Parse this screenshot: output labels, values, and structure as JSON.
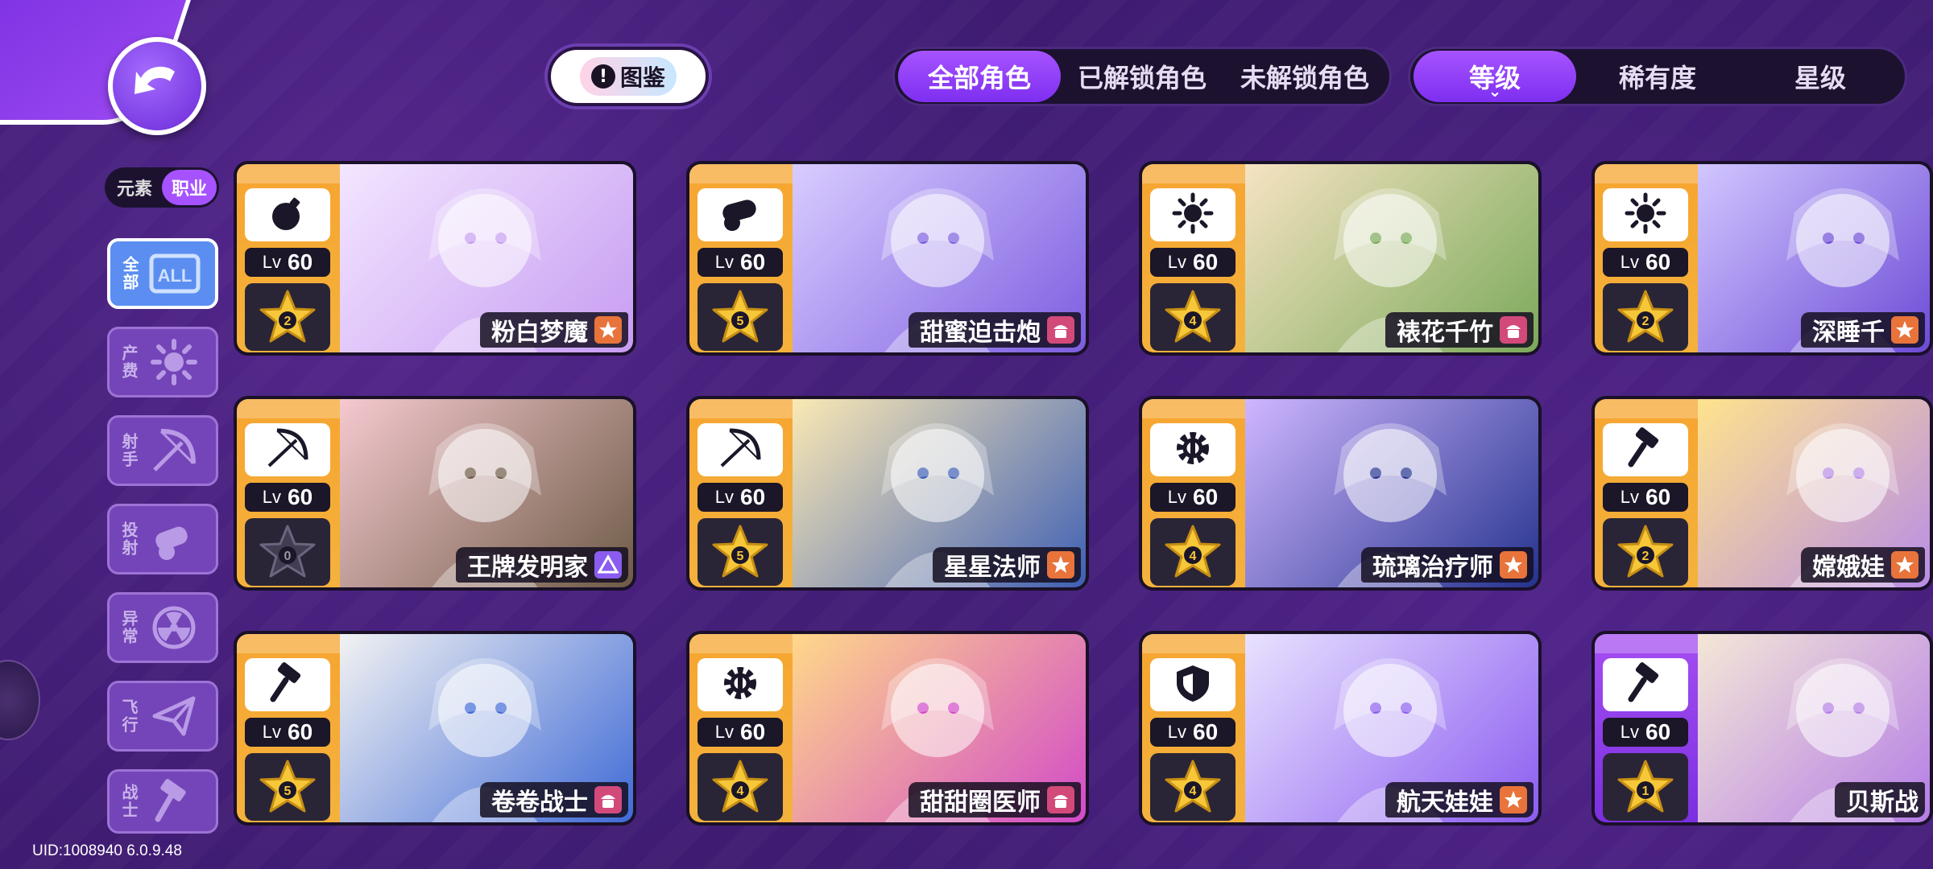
{
  "nav": {
    "handbook_label": "图鉴"
  },
  "role_filter": {
    "items": [
      "全部角色",
      "已解锁角色",
      "未解锁角色"
    ],
    "active": 0
  },
  "sort_filter": {
    "items": [
      "等级",
      "稀有度",
      "星级"
    ],
    "active": 0
  },
  "category_toggle": {
    "items": [
      "元素",
      "职业"
    ],
    "active": 1
  },
  "sidebar": {
    "items": [
      {
        "label": "全部",
        "icon": "all-icon"
      },
      {
        "label": "产费",
        "icon": "sun-icon"
      },
      {
        "label": "射手",
        "icon": "bow-icon"
      },
      {
        "label": "投射",
        "icon": "cannon-icon"
      },
      {
        "label": "异常",
        "icon": "radiation-icon"
      },
      {
        "label": "飞行",
        "icon": "paper-plane-icon"
      },
      {
        "label": "战士",
        "icon": "hammer-icon"
      }
    ]
  },
  "cards": [
    {
      "name": "粉白梦魔",
      "lv_label": "Lv",
      "level": "60",
      "stars": "2",
      "class_icon": "bomb-icon",
      "badge": "star",
      "theme": "orange",
      "art": [
        "#f3e6ff",
        "#c79cf2"
      ]
    },
    {
      "name": "甜蜜迫击炮",
      "lv_label": "Lv",
      "level": "60",
      "stars": "5",
      "class_icon": "cannon-icon",
      "badge": "cake",
      "theme": "orange",
      "art": [
        "#d9ccff",
        "#7c5de0"
      ]
    },
    {
      "name": "裱花千竹",
      "lv_label": "Lv",
      "level": "60",
      "stars": "4",
      "class_icon": "sun-icon",
      "badge": "cake",
      "theme": "orange",
      "art": [
        "#f6e3c2",
        "#7aa95a"
      ]
    },
    {
      "name": "深睡千",
      "lv_label": "Lv",
      "level": "60",
      "stars": "2",
      "class_icon": "sun-icon",
      "badge": "star",
      "theme": "orange",
      "art": [
        "#d2c6ff",
        "#6c4bd6"
      ]
    },
    {
      "name": "王牌发明家",
      "lv_label": "Lv",
      "level": "60",
      "stars": "0",
      "class_icon": "bow-icon",
      "badge": "tri",
      "theme": "orange",
      "art": [
        "#f5c9cf",
        "#6d5a46"
      ]
    },
    {
      "name": "星星法师",
      "lv_label": "Lv",
      "level": "60",
      "stars": "5",
      "class_icon": "bow-icon",
      "badge": "star",
      "theme": "orange",
      "art": [
        "#fbe9b4",
        "#3f5fb4"
      ]
    },
    {
      "name": "琉璃治疗师",
      "lv_label": "Lv",
      "level": "60",
      "stars": "4",
      "class_icon": "gear-icon",
      "badge": "star",
      "theme": "orange",
      "art": [
        "#cfb6ff",
        "#25338e"
      ]
    },
    {
      "name": "嫦娥娃",
      "lv_label": "Lv",
      "level": "60",
      "stars": "2",
      "class_icon": "hammer-icon",
      "badge": "star",
      "theme": "orange",
      "art": [
        "#ffe38d",
        "#b88de6"
      ]
    },
    {
      "name": "卷卷战士",
      "lv_label": "Lv",
      "level": "60",
      "stars": "5",
      "class_icon": "hammer-icon",
      "badge": "cake",
      "theme": "orange",
      "art": [
        "#f2f2f2",
        "#3f6ad6"
      ]
    },
    {
      "name": "甜甜圈医师",
      "lv_label": "Lv",
      "level": "60",
      "stars": "4",
      "class_icon": "gear-icon",
      "badge": "cake",
      "theme": "orange",
      "art": [
        "#ffd88a",
        "#d24ac8"
      ]
    },
    {
      "name": "航天娃娃",
      "lv_label": "Lv",
      "level": "60",
      "stars": "4",
      "class_icon": "shield-icon",
      "badge": "star",
      "theme": "orange",
      "art": [
        "#e9e2ff",
        "#8b5cf0"
      ]
    },
    {
      "name": "贝斯战",
      "lv_label": "Lv",
      "level": "60",
      "stars": "1",
      "class_icon": "hammer-icon",
      "badge": "none",
      "theme": "purple",
      "art": [
        "#f4e7d6",
        "#b47de6"
      ]
    }
  ],
  "footer": {
    "uid": "UID:1008940 6.0.9.48"
  }
}
